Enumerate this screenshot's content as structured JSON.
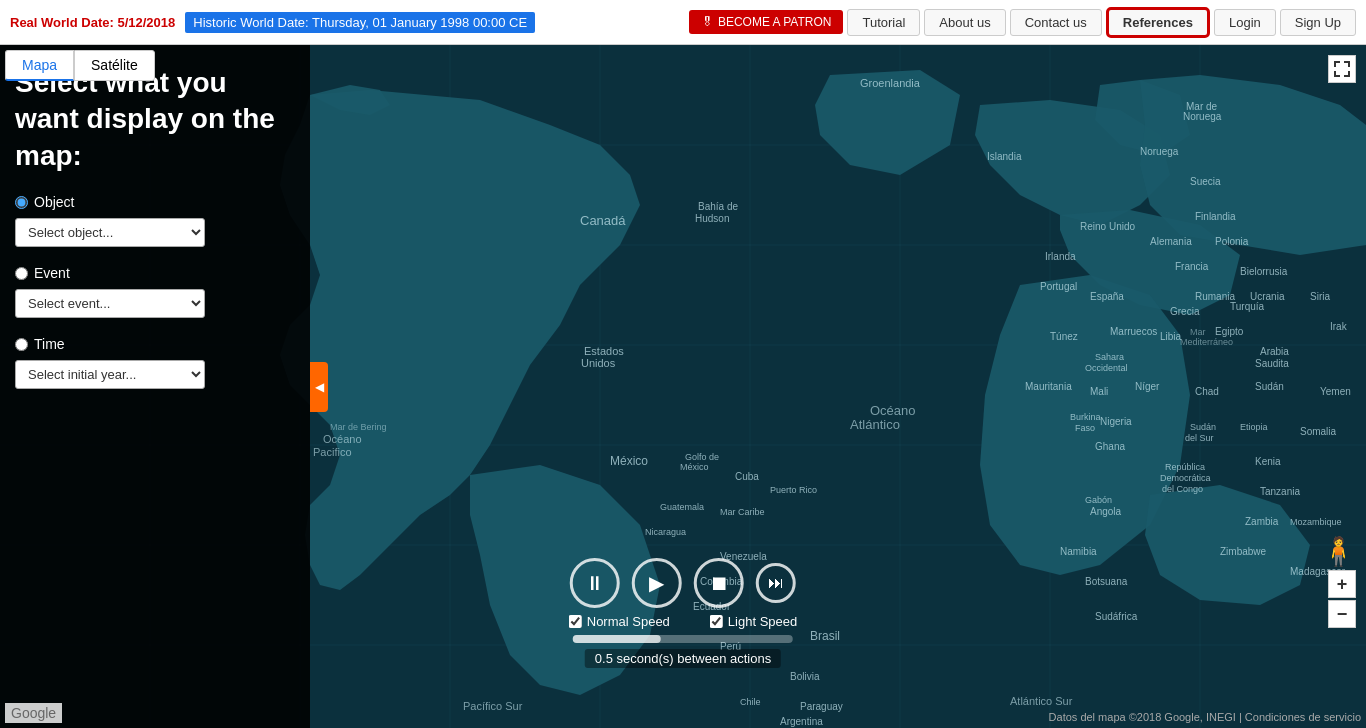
{
  "header": {
    "real_date_label": "Real World Date:",
    "real_date_value": "5/12/2018",
    "historic_date_label": "Historic World Date:",
    "historic_date_value": "Thursday, 01 January 1998 00:00 CE",
    "patron_btn": "BECOME A PATRON",
    "nav": {
      "tutorial": "Tutorial",
      "about_us": "About us",
      "contact_us": "Contact us",
      "references": "References",
      "login": "Login",
      "sign_up": "Sign Up"
    }
  },
  "map": {
    "tab_mapa": "Mapa",
    "tab_satelite": "Satélite"
  },
  "sidebar": {
    "title": "Select what you want display on the map:",
    "object_label": "Object",
    "object_placeholder": "Select object...",
    "event_label": "Event",
    "event_placeholder": "Select event...",
    "time_label": "Time",
    "year_placeholder": "Select initial year...",
    "collapse_arrow": "◀"
  },
  "playback": {
    "pause_icon": "⏸",
    "play_icon": "▶",
    "stop_icon": "⏹",
    "ff_icon": "⏭",
    "normal_speed_label": "Normal Speed",
    "light_speed_label": "Light Speed",
    "timer_label": "0.5 second(s) between actions",
    "progress_pct": 40
  },
  "zoom": {
    "plus": "+",
    "minus": "−"
  },
  "footer": {
    "google_label": "Google",
    "map_credit": "Datos del mapa ©2018 Google, INEGI | Condiciones de servicio"
  }
}
